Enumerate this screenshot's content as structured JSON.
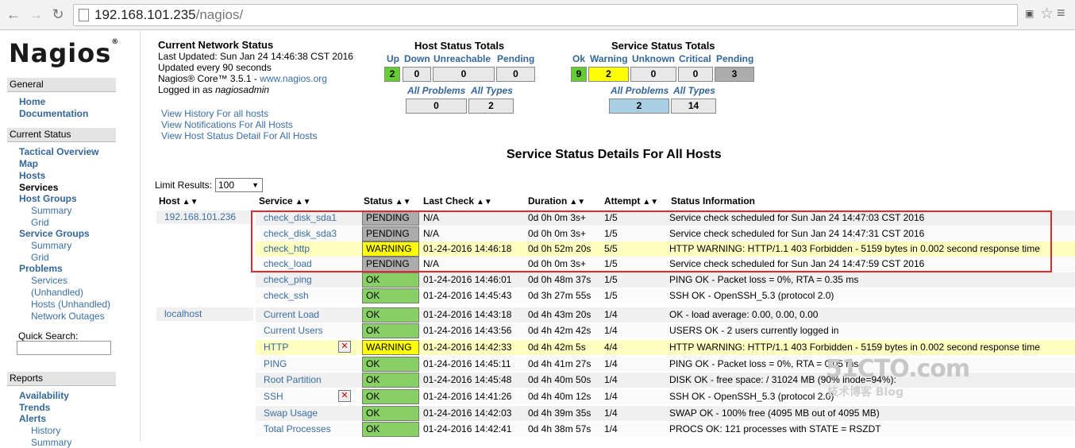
{
  "browser": {
    "url_host": "192.168.101.235",
    "url_path": "/nagios/"
  },
  "sidebar": {
    "logo": "Nagios",
    "logo_mark": "®",
    "general": "General",
    "home": "Home",
    "documentation": "Documentation",
    "current_status": "Current Status",
    "tactical": "Tactical Overview",
    "map": "Map",
    "hosts": "Hosts",
    "services": "Services",
    "host_groups": "Host Groups",
    "hg_summary": "Summary",
    "hg_grid": "Grid",
    "service_groups": "Service Groups",
    "sg_summary": "Summary",
    "sg_grid": "Grid",
    "problems": "Problems",
    "p_services": "Services",
    "p_unhandled": "(Unhandled)",
    "p_hosts": "Hosts (Unhandled)",
    "p_outages": "Network Outages",
    "quick_search": "Quick Search:",
    "reports": "Reports",
    "availability": "Availability",
    "trends": "Trends",
    "alerts": "Alerts",
    "a_history": "History",
    "a_summary": "Summary"
  },
  "network_status": {
    "title": "Current Network Status",
    "updated": "Last Updated: Sun Jan 24 14:46:38 CST 2016",
    "interval": "Updated every 90 seconds",
    "core_prefix": "Nagios® Core™ 3.5.1 - ",
    "core_link": "www.nagios.org",
    "logged_prefix": "Logged in as ",
    "logged_user": "nagiosadmin",
    "view_history": "View History For all hosts",
    "view_notifications": "View Notifications For All Hosts",
    "view_host_status": "View Host Status Detail For All Hosts"
  },
  "host_totals": {
    "title": "Host Status Totals",
    "up_label": "Up",
    "down_label": "Down",
    "unreachable_label": "Unreachable",
    "pending_label": "Pending",
    "up": "2",
    "down": "0",
    "unreachable": "0",
    "pending": "0",
    "all_problems_label": "All Problems",
    "all_types_label": "All Types",
    "all_problems": "0",
    "all_types": "2"
  },
  "service_totals": {
    "title": "Service Status Totals",
    "ok_label": "Ok",
    "warning_label": "Warning",
    "unknown_label": "Unknown",
    "critical_label": "Critical",
    "pending_label": "Pending",
    "ok": "9",
    "warning": "2",
    "unknown": "0",
    "critical": "0",
    "pending": "3",
    "all_problems_label": "All Problems",
    "all_types_label": "All Types",
    "all_problems": "2",
    "all_types": "14"
  },
  "details": {
    "title": "Service Status Details For All Hosts",
    "limit_label": "Limit Results:",
    "limit_value": "100",
    "columns": [
      "Host",
      "Service",
      "Status",
      "Last Check",
      "Duration",
      "Attempt",
      "Status Information"
    ],
    "hosts": [
      "192.168.101.236",
      "localhost"
    ],
    "rows": [
      {
        "service": "check_disk_sda1",
        "status": "PENDING",
        "last": "N/A",
        "dur": "0d 0h 0m 3s+",
        "att": "1/5",
        "info": "Service check scheduled for Sun Jan 24 14:47:03 CST 2016"
      },
      {
        "service": "check_disk_sda3",
        "status": "PENDING",
        "last": "N/A",
        "dur": "0d 0h 0m 3s+",
        "att": "1/5",
        "info": "Service check scheduled for Sun Jan 24 14:47:31 CST 2016"
      },
      {
        "service": "check_http",
        "status": "WARNING",
        "last": "01-24-2016 14:46:18",
        "dur": "0d 0h 52m 20s",
        "att": "5/5",
        "info": "HTTP WARNING: HTTP/1.1 403 Forbidden - 5159 bytes in 0.002 second response time"
      },
      {
        "service": "check_load",
        "status": "PENDING",
        "last": "N/A",
        "dur": "0d 0h 0m 3s+",
        "att": "1/5",
        "info": "Service check scheduled for Sun Jan 24 14:47:59 CST 2016"
      },
      {
        "service": "check_ping",
        "status": "OK",
        "last": "01-24-2016 14:46:01",
        "dur": "0d 0h 48m 37s",
        "att": "1/5",
        "info": "PING OK - Packet loss = 0%, RTA = 0.35 ms"
      },
      {
        "service": "check_ssh",
        "status": "OK",
        "last": "01-24-2016 14:45:43",
        "dur": "0d 3h 27m 55s",
        "att": "1/5",
        "info": "SSH OK - OpenSSH_5.3 (protocol 2.0)"
      },
      {
        "service": "Current Load",
        "status": "OK",
        "last": "01-24-2016 14:43:18",
        "dur": "0d 4h 43m 20s",
        "att": "1/4",
        "info": "OK - load average: 0.00, 0.00, 0.00"
      },
      {
        "service": "Current Users",
        "status": "OK",
        "last": "01-24-2016 14:43:56",
        "dur": "0d 4h 42m 42s",
        "att": "1/4",
        "info": "USERS OK - 2 users currently logged in"
      },
      {
        "service": "HTTP",
        "status": "WARNING",
        "last": "01-24-2016 14:42:33",
        "dur": "0d 4h 42m 5s",
        "att": "4/4",
        "info": "HTTP WARNING: HTTP/1.1 403 Forbidden - 5159 bytes in 0.002 second response time"
      },
      {
        "service": "PING",
        "status": "OK",
        "last": "01-24-2016 14:45:11",
        "dur": "0d 4h 41m 27s",
        "att": "1/4",
        "info": "PING OK - Packet loss = 0%, RTA = 0.05 ms"
      },
      {
        "service": "Root Partition",
        "status": "OK",
        "last": "01-24-2016 14:45:48",
        "dur": "0d 4h 40m 50s",
        "att": "1/4",
        "info": "DISK OK - free space: / 31024 MB (90% inode=94%):"
      },
      {
        "service": "SSH",
        "status": "OK",
        "last": "01-24-2016 14:41:26",
        "dur": "0d 4h 40m 12s",
        "att": "1/4",
        "info": "SSH OK - OpenSSH_5.3 (protocol 2.0)"
      },
      {
        "service": "Swap Usage",
        "status": "OK",
        "last": "01-24-2016 14:42:03",
        "dur": "0d 4h 39m 35s",
        "att": "1/4",
        "info": "SWAP OK - 100% free (4095 MB out of 4095 MB)"
      },
      {
        "service": "Total Processes",
        "status": "OK",
        "last": "01-24-2016 14:42:41",
        "dur": "0d 4h 38m 57s",
        "att": "1/4",
        "info": "PROCS OK: 121 processes with STATE = RSZDT"
      }
    ]
  },
  "watermark": {
    "brand": "51CTO.com",
    "sub": "技术博客  Blog"
  },
  "colors": {
    "ok": "#88d066",
    "warning": "#ffff00",
    "pending": "#acacac",
    "highlight_box": "#e0282e"
  }
}
